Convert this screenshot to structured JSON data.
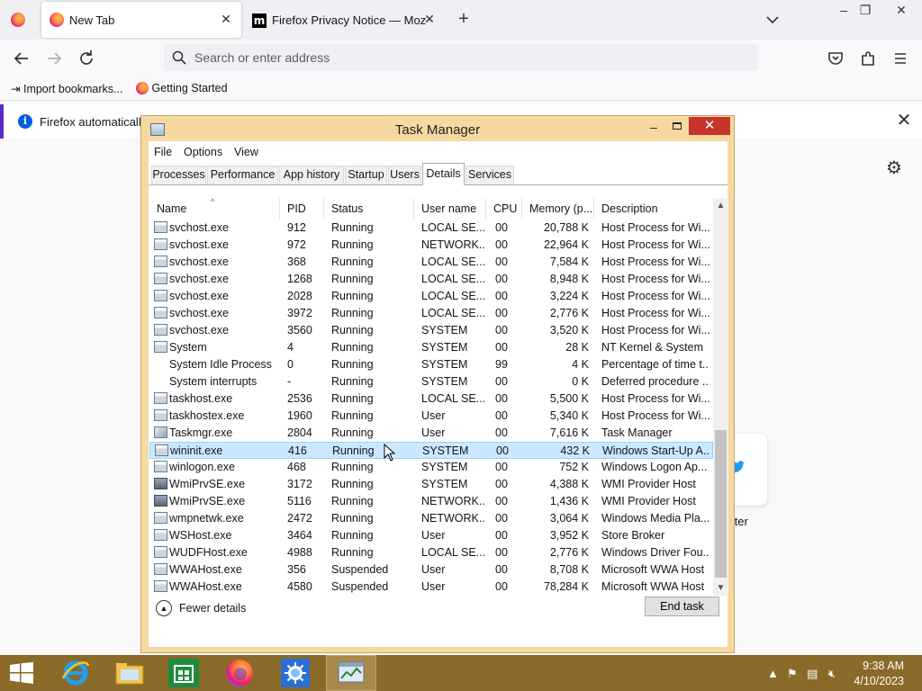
{
  "browser": {
    "tabs": [
      {
        "title": "New Tab",
        "icon": "firefox-icon"
      },
      {
        "title": "Firefox Privacy Notice — Mozilla",
        "icon": "mozilla-icon"
      }
    ],
    "urlbar_placeholder": "Search or enter address",
    "bookmarks": [
      {
        "label": "Import bookmarks...",
        "icon": "import-icon"
      },
      {
        "label": "Getting Started",
        "icon": "firefox-icon"
      }
    ],
    "notification_text": "Firefox automatically",
    "tile_label": "tter"
  },
  "taskmgr": {
    "title": "Task Manager",
    "menu": [
      "File",
      "Options",
      "View"
    ],
    "tabs": [
      "Processes",
      "Performance",
      "App history",
      "Startup",
      "Users",
      "Details",
      "Services"
    ],
    "active_tab": "Details",
    "columns": [
      "Name",
      "PID",
      "Status",
      "User name",
      "CPU",
      "Memory (p...",
      "Description"
    ],
    "rows": [
      {
        "name": "svchost.exe",
        "pid": "912",
        "status": "Running",
        "user": "LOCAL SE...",
        "cpu": "00",
        "mem": "20,788 K",
        "desc": "Host Process for Wi...",
        "icon": "generic"
      },
      {
        "name": "svchost.exe",
        "pid": "972",
        "status": "Running",
        "user": "NETWORK...",
        "cpu": "00",
        "mem": "22,964 K",
        "desc": "Host Process for Wi...",
        "icon": "generic"
      },
      {
        "name": "svchost.exe",
        "pid": "368",
        "status": "Running",
        "user": "LOCAL SE...",
        "cpu": "00",
        "mem": "7,584 K",
        "desc": "Host Process for Wi...",
        "icon": "generic"
      },
      {
        "name": "svchost.exe",
        "pid": "1268",
        "status": "Running",
        "user": "LOCAL SE...",
        "cpu": "00",
        "mem": "8,948 K",
        "desc": "Host Process for Wi...",
        "icon": "generic"
      },
      {
        "name": "svchost.exe",
        "pid": "2028",
        "status": "Running",
        "user": "LOCAL SE...",
        "cpu": "00",
        "mem": "3,224 K",
        "desc": "Host Process for Wi...",
        "icon": "generic"
      },
      {
        "name": "svchost.exe",
        "pid": "3972",
        "status": "Running",
        "user": "LOCAL SE...",
        "cpu": "00",
        "mem": "2,776 K",
        "desc": "Host Process for Wi...",
        "icon": "generic"
      },
      {
        "name": "svchost.exe",
        "pid": "3560",
        "status": "Running",
        "user": "SYSTEM",
        "cpu": "00",
        "mem": "3,520 K",
        "desc": "Host Process for Wi...",
        "icon": "generic"
      },
      {
        "name": "System",
        "pid": "4",
        "status": "Running",
        "user": "SYSTEM",
        "cpu": "00",
        "mem": "28 K",
        "desc": "NT Kernel & System",
        "icon": "generic"
      },
      {
        "name": "System Idle Process",
        "pid": "0",
        "status": "Running",
        "user": "SYSTEM",
        "cpu": "99",
        "mem": "4 K",
        "desc": "Percentage of time t...",
        "icon": "none"
      },
      {
        "name": "System interrupts",
        "pid": "-",
        "status": "Running",
        "user": "SYSTEM",
        "cpu": "00",
        "mem": "0 K",
        "desc": "Deferred procedure ...",
        "icon": "none"
      },
      {
        "name": "taskhost.exe",
        "pid": "2536",
        "status": "Running",
        "user": "LOCAL SE...",
        "cpu": "00",
        "mem": "5,500 K",
        "desc": "Host Process for Wi...",
        "icon": "generic"
      },
      {
        "name": "taskhostex.exe",
        "pid": "1960",
        "status": "Running",
        "user": "User",
        "cpu": "00",
        "mem": "5,340 K",
        "desc": "Host Process for Wi...",
        "icon": "generic"
      },
      {
        "name": "Taskmgr.exe",
        "pid": "2804",
        "status": "Running",
        "user": "User",
        "cpu": "00",
        "mem": "7,616 K",
        "desc": "Task Manager",
        "icon": "taskmgr"
      },
      {
        "name": "wininit.exe",
        "pid": "416",
        "status": "Running",
        "user": "SYSTEM",
        "cpu": "00",
        "mem": "432 K",
        "desc": "Windows Start-Up A...",
        "icon": "generic",
        "selected": true
      },
      {
        "name": "winlogon.exe",
        "pid": "468",
        "status": "Running",
        "user": "SYSTEM",
        "cpu": "00",
        "mem": "752 K",
        "desc": "Windows Logon Ap...",
        "icon": "generic"
      },
      {
        "name": "WmiPrvSE.exe",
        "pid": "3172",
        "status": "Running",
        "user": "SYSTEM",
        "cpu": "00",
        "mem": "4,388 K",
        "desc": "WMI Provider Host",
        "icon": "wmi"
      },
      {
        "name": "WmiPrvSE.exe",
        "pid": "5116",
        "status": "Running",
        "user": "NETWORK...",
        "cpu": "00",
        "mem": "1,436 K",
        "desc": "WMI Provider Host",
        "icon": "wmi"
      },
      {
        "name": "wmpnetwk.exe",
        "pid": "2472",
        "status": "Running",
        "user": "NETWORK...",
        "cpu": "00",
        "mem": "3,064 K",
        "desc": "Windows Media Pla...",
        "icon": "generic"
      },
      {
        "name": "WSHost.exe",
        "pid": "3464",
        "status": "Running",
        "user": "User",
        "cpu": "00",
        "mem": "3,952 K",
        "desc": "Store Broker",
        "icon": "generic"
      },
      {
        "name": "WUDFHost.exe",
        "pid": "4988",
        "status": "Running",
        "user": "LOCAL SE...",
        "cpu": "00",
        "mem": "2,776 K",
        "desc": "Windows Driver Fou...",
        "icon": "generic"
      },
      {
        "name": "WWAHost.exe",
        "pid": "356",
        "status": "Suspended",
        "user": "User",
        "cpu": "00",
        "mem": "8,708 K",
        "desc": "Microsoft WWA Host",
        "icon": "generic"
      },
      {
        "name": "WWAHost.exe",
        "pid": "4580",
        "status": "Suspended",
        "user": "User",
        "cpu": "00",
        "mem": "78,284 K",
        "desc": "Microsoft WWA Host",
        "icon": "generic"
      }
    ],
    "fewer_details": "Fewer details",
    "end_task": "End task"
  },
  "taskbar": {
    "apps": [
      "internet-explorer-icon",
      "file-explorer-icon",
      "store-icon",
      "firefox-icon",
      "settings-app-icon",
      "task-manager-icon"
    ],
    "time": "9:38 AM",
    "date": "4/10/2023"
  },
  "colors": {
    "window_frame": "#f5d9a1",
    "taskbar": "#8a6a28",
    "selection": "#cce8ff",
    "close_button": "#c7352a"
  }
}
